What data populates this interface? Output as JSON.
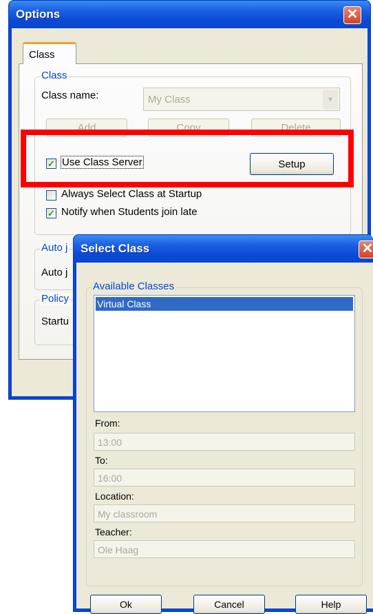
{
  "options": {
    "title": "Options",
    "close_symbol": "✕",
    "tab": "Class",
    "class_group": {
      "title": "Class",
      "class_name_label": "Class name:",
      "class_name_value": "My Class",
      "add_label": "Add",
      "copy_label": "Copy",
      "delete_label": "Delete",
      "use_class_server_label": "Use Class Server",
      "use_class_server_checked": true,
      "setup_label": "Setup",
      "always_select_label": "Always Select Class at Startup",
      "always_select_checked": false,
      "notify_label": "Notify when Students join late",
      "notify_checked": true
    },
    "auto_group": {
      "title": "Auto j",
      "label": "Auto j"
    },
    "policy_group": {
      "title": "Policy",
      "label": "Startu"
    }
  },
  "select_class": {
    "title": "Select Class",
    "close_symbol": "✕",
    "available_title": "Available Classes",
    "classes": [
      "Virtual Class"
    ],
    "from_label": "From:",
    "from_value": "13:00",
    "to_label": "To:",
    "to_value": "16:00",
    "location_label": "Location:",
    "location_value": "My classroom",
    "teacher_label": "Teacher:",
    "teacher_value": "Ole Haag",
    "ok_label": "Ok",
    "cancel_label": "Cancel",
    "help_label": "Help"
  }
}
